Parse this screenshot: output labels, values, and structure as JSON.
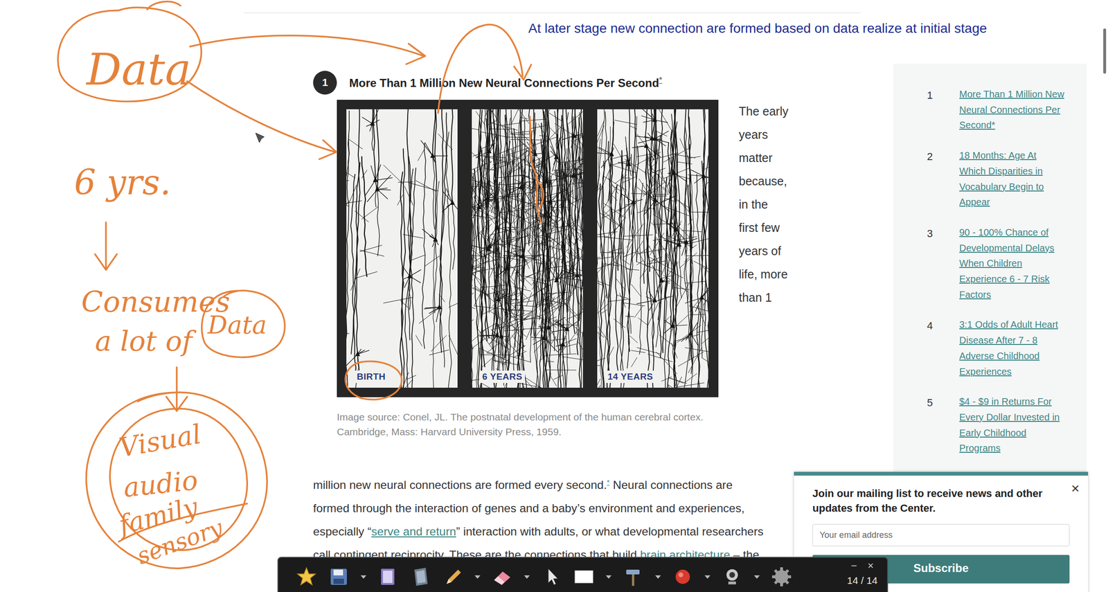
{
  "annotation": {
    "note": "At later stage new connection are formed based on data realize at initial stage",
    "handwriting": [
      {
        "text": "Data"
      },
      {
        "text": "6 yrs."
      },
      {
        "text": "Consumes"
      },
      {
        "text": "a lot of"
      },
      {
        "text": "Data"
      },
      {
        "text": "Visual"
      },
      {
        "text": "audio"
      },
      {
        "text": "family"
      },
      {
        "text": "sensory"
      }
    ]
  },
  "article": {
    "section_number": "1",
    "heading": "More Than 1 Million New Neural Connections Per Second",
    "heading_note": "*",
    "figure": {
      "panels": [
        "BIRTH",
        "6 YEARS",
        "14 YEARS"
      ],
      "caption": "Image source: Conel, JL. The postnatal development of the human cerebral cortex. Cambridge, Mass: Harvard University Press, 1959."
    },
    "side_text": [
      "The early",
      "years",
      "matter",
      "because,",
      "in the",
      "first few",
      "years of",
      "life, more",
      "than 1"
    ],
    "paragraph": [
      [
        {
          "kind": "text",
          "text": "million new neural connections are formed every second."
        },
        {
          "kind": "sup",
          "text": "*"
        },
        {
          "kind": "text",
          "text": " Neural connections are"
        }
      ],
      [
        {
          "kind": "text",
          "text": "formed through the interaction of genes and a baby’s environment and experiences,"
        }
      ],
      [
        {
          "kind": "text",
          "text": "especially “"
        },
        {
          "kind": "link",
          "text": "serve and return"
        },
        {
          "kind": "text",
          "text": "” interaction with adults, or what developmental researchers"
        }
      ],
      [
        {
          "kind": "text",
          "text": "call contingent reciprocity. These are the connections that build "
        },
        {
          "kind": "link",
          "text": "brain architecture"
        },
        {
          "kind": "text",
          "text": " – the"
        }
      ]
    ]
  },
  "sidebar": {
    "items": [
      {
        "number": "1",
        "label": "More Than 1 Million New Neural Connections Per Second*"
      },
      {
        "number": "2",
        "label": "18 Months: Age At Which Disparities in Vocabulary Begin to Appear"
      },
      {
        "number": "3",
        "label": "90 - 100% Chance of Developmental Delays When Children Experience 6 - 7 Risk Factors"
      },
      {
        "number": "4",
        "label": "3:1 Odds of Adult Heart Disease After 7 - 8 Adverse Childhood Experiences"
      },
      {
        "number": "5",
        "label": "$4 - $9 in Returns For Every Dollar Invested in Early Childhood Programs"
      }
    ]
  },
  "popup": {
    "close": "×",
    "title": "Join our mailing list to receive news and other updates from the Center.",
    "email_placeholder": "Your email address",
    "button": "Subscribe"
  },
  "toolbar": {
    "minimize": "−",
    "close": "×",
    "page": "14 / 14"
  }
}
